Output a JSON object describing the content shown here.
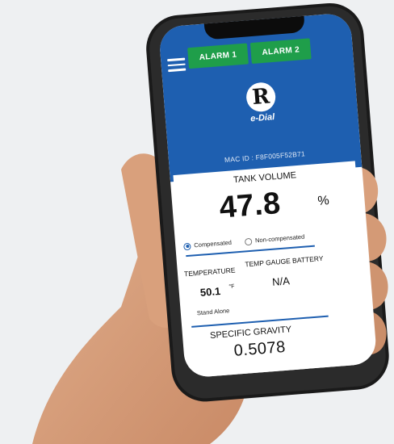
{
  "header": {
    "alarm1_label": "ALARM 1",
    "alarm2_label": "ALARM 2"
  },
  "logo": {
    "letter": "R",
    "brand": "e-Dial"
  },
  "device": {
    "mac": "MAC ID : F8F005F52B71"
  },
  "tank_volume": {
    "title": "TANK VOLUME",
    "value": "47.8",
    "unit": "%",
    "option_compensated": "Compensated",
    "option_noncompensated": "Non-compensated",
    "selected": "Compensated"
  },
  "temperature": {
    "label": "TEMPERATURE",
    "value": "50.1",
    "unit": "°F",
    "note": "Stand Alone"
  },
  "battery": {
    "label": "TEMP GAUGE BATTERY",
    "value": "N/A"
  },
  "specific_gravity": {
    "label": "SPECIFIC GRAVITY",
    "value": "0.5078"
  },
  "colors": {
    "primary_blue": "#1e5fb0",
    "alarm_green": "#1f9e4a"
  }
}
